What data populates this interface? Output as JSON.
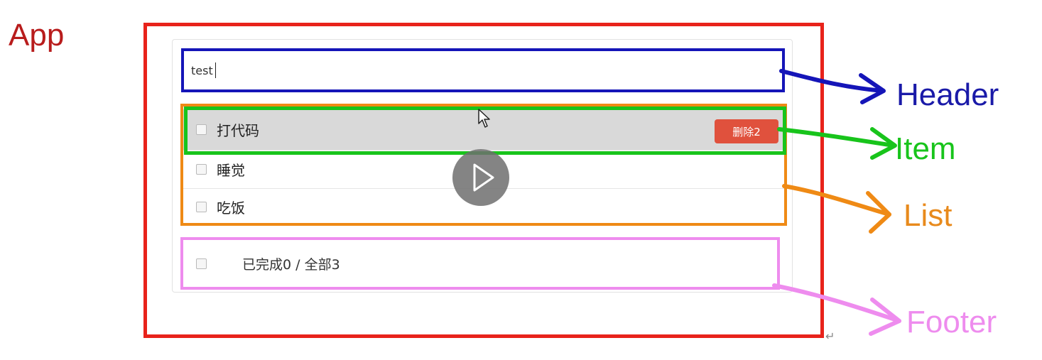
{
  "labels": {
    "app": "App",
    "header": "Header",
    "item": "Item",
    "list": "List",
    "footer": "Footer"
  },
  "header": {
    "input_value": "test"
  },
  "list": {
    "items": [
      {
        "text": "打代码",
        "delete_label": "删除2"
      },
      {
        "text": "睡觉"
      },
      {
        "text": "吃饭"
      }
    ]
  },
  "footer": {
    "summary": "已完成0 / 全部3"
  },
  "colors": {
    "app": "#e8231b",
    "header": "#1515b8",
    "item": "#18c41b",
    "list": "#ef8a15",
    "footer": "#ee8cee",
    "delete_button": "#e0513d"
  },
  "icons": {
    "play": "play-icon",
    "cursor": "cursor-icon",
    "return": "return-arrow-icon"
  }
}
